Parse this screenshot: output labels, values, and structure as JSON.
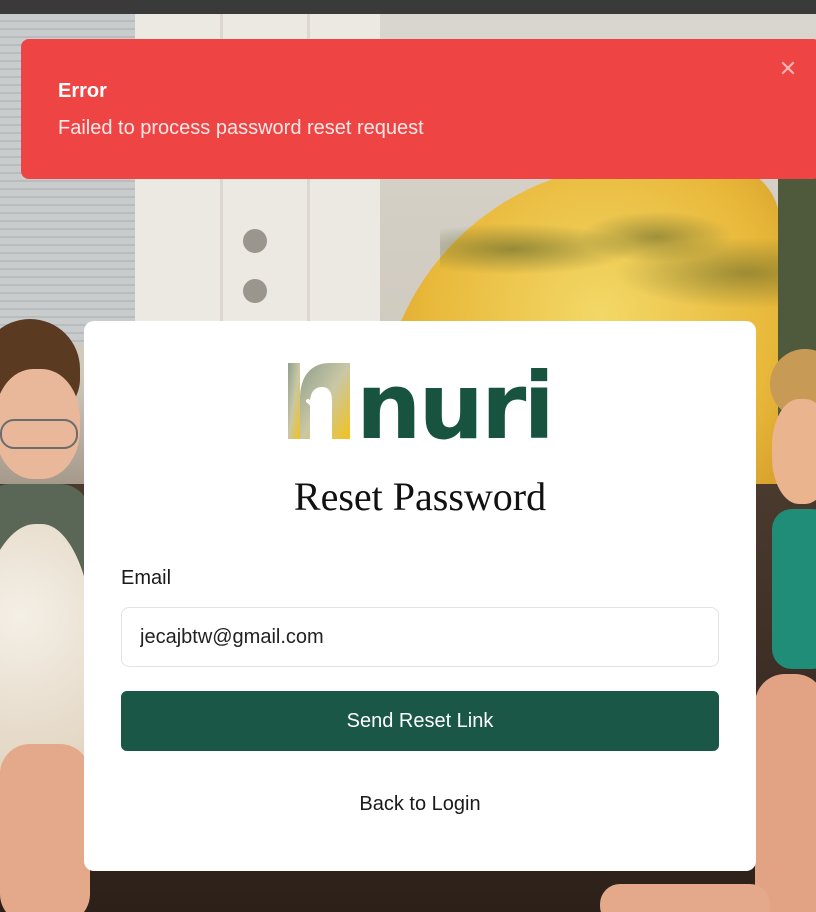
{
  "toast": {
    "title": "Error",
    "message": "Failed to process password reset request",
    "close_icon": "close-icon",
    "color": "#ef4444"
  },
  "brand": {
    "name": "nuri",
    "icon": "nuri-logo-mark",
    "text_color": "#17533f"
  },
  "form": {
    "title": "Reset Password",
    "email_label": "Email",
    "email_value": "jecajbtw@gmail.com",
    "submit_label": "Send Reset Link",
    "back_link": "Back to Login",
    "button_color": "#1b5746"
  }
}
